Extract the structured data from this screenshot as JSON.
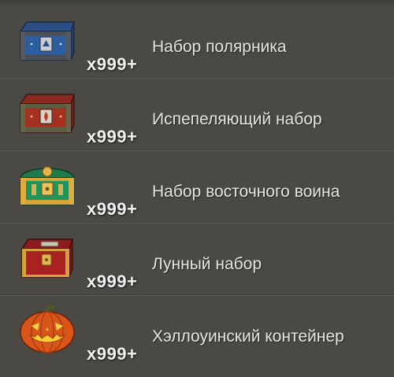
{
  "items": [
    {
      "icon": "blue-arctic-chest-icon",
      "title": "Набор полярника",
      "count": "x999+"
    },
    {
      "icon": "red-fire-chest-icon",
      "title": "Испепеляющий набор",
      "count": "x999+"
    },
    {
      "icon": "green-oriental-chest-icon",
      "title": "Набор восточного воина",
      "count": "x999+"
    },
    {
      "icon": "red-lunar-chest-icon",
      "title": "Лунный набор",
      "count": "x999+"
    },
    {
      "icon": "jack-o-lantern-container-icon",
      "title": "Хэллоуинский контейнер",
      "count": "x999+"
    }
  ]
}
